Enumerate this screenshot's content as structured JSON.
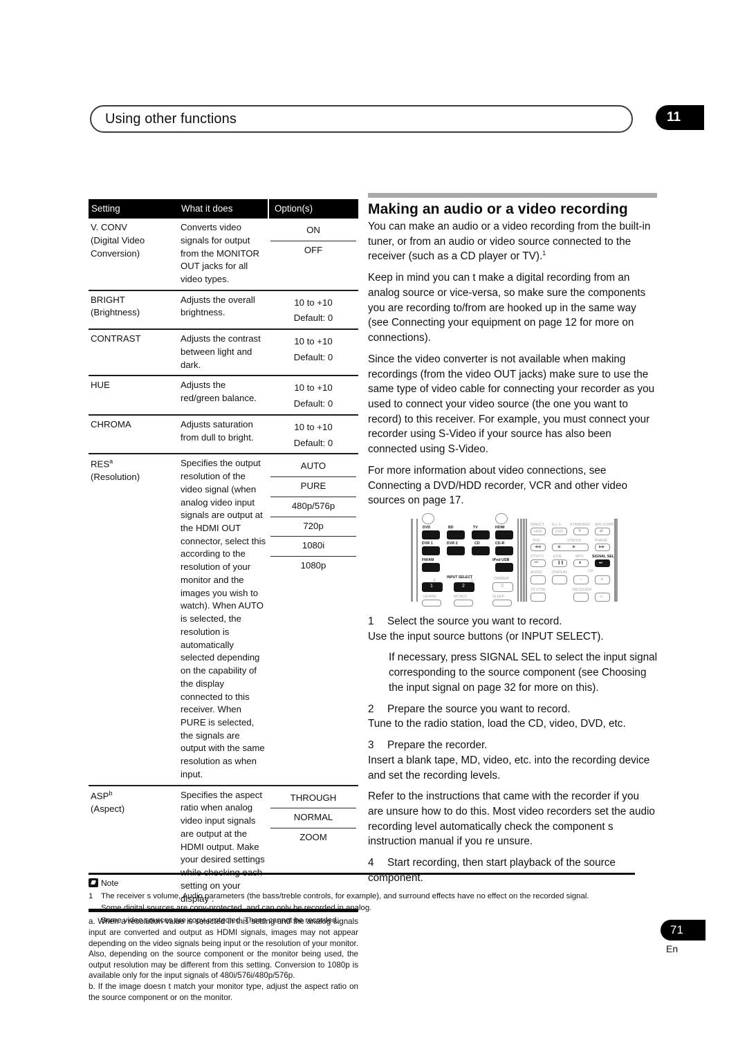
{
  "header": {
    "running_head": "Using other functions",
    "chapter_number": "11"
  },
  "table": {
    "columns": [
      "Setting",
      "What it does",
      "Option(s)"
    ],
    "rows": [
      {
        "setting": "V. CONV",
        "setting_sub": "(Digital Video Conversion)",
        "description": "Converts video signals for output from the MONITOR OUT jacks for all video types.",
        "options": [
          "ON",
          "OFF"
        ],
        "options_style": "divided"
      },
      {
        "setting": "BRIGHT",
        "setting_sub": "(Brightness)",
        "description": "Adjusts the overall brightness.",
        "options": [
          "10 to +10",
          "Default: 0"
        ],
        "options_style": "plain"
      },
      {
        "setting": "CONTRAST",
        "setting_sub": "",
        "description": "Adjusts the contrast between light and dark.",
        "options": [
          "10 to +10",
          "Default: 0"
        ],
        "options_style": "plain"
      },
      {
        "setting": "HUE",
        "setting_sub": "",
        "description": "Adjusts the red/green balance.",
        "options": [
          "10 to +10",
          "Default: 0"
        ],
        "options_style": "plain"
      },
      {
        "setting": "CHROMA",
        "setting_sub": "",
        "description": "Adjusts saturation from dull to bright.",
        "options": [
          "10 to +10",
          "Default: 0"
        ],
        "options_style": "plain"
      },
      {
        "setting": "RES",
        "setting_superscript": "a",
        "setting_sub": "(Resolution)",
        "description": "Specifies the output resolution of the video signal (when analog video input signals are output at the HDMI OUT connector, select this according to the resolution of your monitor and the images you wish to watch). When AUTO is selected, the resolution is automatically selected depending on the capability of the display connected to this receiver. When PURE is selected, the signals are output with the same resolution as when input.",
        "options": [
          "AUTO",
          "PURE",
          "480p/576p",
          "720p",
          "1080i",
          "1080p"
        ],
        "options_style": "divided"
      },
      {
        "setting": "ASP",
        "setting_superscript": "b",
        "setting_sub": "(Aspect)",
        "description": "Specifies the aspect ratio when analog video input signals are output at the HDMI output. Make your desired settings while checking each setting on your display .",
        "options": [
          "THROUGH",
          "NORMAL",
          "ZOOM"
        ],
        "options_style": "divided"
      }
    ]
  },
  "footnotes": {
    "a": "a. When a resolution value is selected in this setting and the analog signals input are converted and output as HDMI signals, images may not appear depending on the video signals being input or the resolution of your monitor. Also, depending on the source component or the monitor being used, the output resolution may be different from this setting. Conversion to 1080p is available only for the input signals of 480i/576i/480p/576p.",
    "b": "b. If the image doesn t match your monitor type, adjust the aspect ratio on the source component or on the monitor."
  },
  "section": {
    "title": "Making an audio or a video recording",
    "paragraphs": [
      "You can make an audio or a video recording from the built-in tuner, or from an audio or video source connected to the receiver (such as a CD player or TV).",
      "Keep in mind you can t make a digital recording from an analog source or vice-versa, so make sure the components you are recording to/from are hooked up in the same way (see Connecting your equipment on page 12 for more on connections).",
      "Since the video converter is not available when making recordings (from the video OUT jacks) make sure to use the same type of video cable for connecting your recorder as you used to connect your video source (the one you want to record) to this receiver. For example, you must connect your recorder using S-Video if your source has also been connected using S-Video.",
      "For more information about video connections, see Connecting a DVD/HDD recorder, VCR and other video sources on page 17."
    ],
    "paragraph_1_superscript": "1",
    "steps": [
      {
        "number": "1",
        "title": "Select the source you want to record.",
        "detail": "Use the input source buttons (or INPUT SELECT).",
        "note": "If necessary, press SIGNAL SEL to select the input signal corresponding to the source component (see Choosing the input signal on page 32 for more on this)."
      },
      {
        "number": "2",
        "title": "Prepare the source you want to record.",
        "detail": "Tune to the radio station, load the CD, video, DVD, etc.",
        "note": ""
      },
      {
        "number": "3",
        "title": "Prepare the recorder.",
        "detail": "Insert a blank tape, MD, video, etc. into the recording device and set the recording levels.",
        "note": "Refer to the instructions that came with the recorder if you are unsure how to do this. Most video recorders set the audio recording level automatically check the component s instruction manual if you re unsure.",
        "note_full_width": true
      },
      {
        "number": "4",
        "title": "Start recording, then start playback of the source component.",
        "detail": "",
        "note": ""
      }
    ]
  },
  "remote": {
    "left_panel": {
      "source_buttons_row1": [
        "DVD",
        "BD",
        "TV",
        "HDMI"
      ],
      "source_buttons_row2": [
        "DVR 1",
        "DVR 2",
        "CD",
        "CD-R"
      ],
      "source_buttons_row3": [
        "FM/AM",
        "iPod USB"
      ],
      "input_select_label": "INPUT SELECT",
      "numeric_buttons": [
        "1",
        "2",
        "3"
      ],
      "dimmer_label": "DIMMER",
      "bottom_labels": [
        "GENRE",
        "MCACC",
        "SLEEP"
      ]
    },
    "right_panel": {
      "row1_labels": [
        "DIRECT",
        "A.L.C.",
        "STANDARD",
        "ADV.SURR"
      ],
      "row1_buttons": [
        "HDD",
        "DVD",
        "repeat-icon",
        "shuffle-icon"
      ],
      "row2_labels": [
        "THX",
        "STATUS",
        "PHASE"
      ],
      "row3_labels": [
        "DTV/TV",
        "EON",
        "MPX",
        "SIGNAL SEL"
      ],
      "row4_labels": [
        "AUDIO",
        "DISPLAY",
        "CH"
      ],
      "row5_labels": [
        "TV CTRL",
        "RECEIVER"
      ]
    }
  },
  "note_block": {
    "heading": "Note",
    "number": "1",
    "lines": [
      "The receiver s volume, Audio parameters (the bass/treble controls, for example), and surround effects have no effect on the recorded signal.",
      "Some digital sources are copy-protected, and can only be recorded in analog.",
      "Some video sources are copy-protected. These cannot be recorded."
    ]
  },
  "footer": {
    "page_number": "71",
    "language": "En"
  }
}
